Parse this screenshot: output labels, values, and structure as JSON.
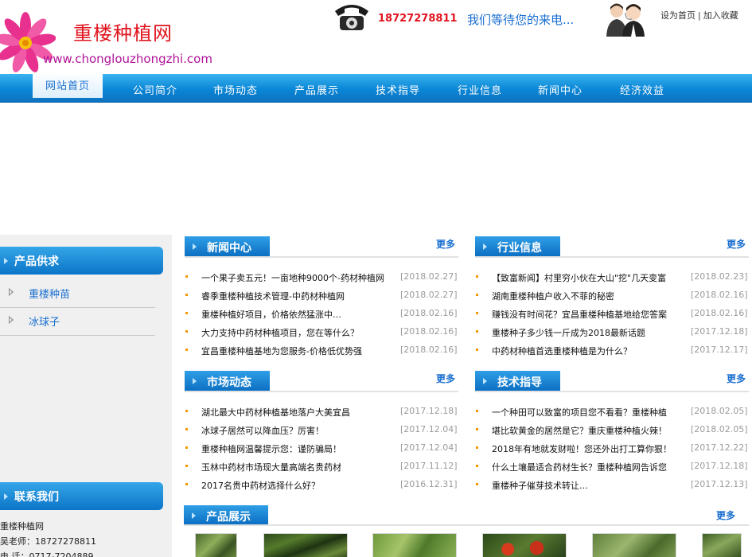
{
  "header": {
    "site_title": "重楼种植网",
    "site_url": "www.chonglouzhongzhi.com",
    "phone": "18727278811",
    "hotline_text": "我们等待您的来电...",
    "set_home": "设为首页",
    "separator": "|",
    "add_favorite": "加入收藏"
  },
  "nav": {
    "items": [
      "网站首页",
      "公司简介",
      "市场动态",
      "产品展示",
      "技术指导",
      "行业信息",
      "新闻中心",
      "经济效益"
    ]
  },
  "left": {
    "supply_title": "产品供求",
    "supply_items": [
      "重楼种苗",
      "冰球子"
    ],
    "contact_title": "联系我们",
    "contact_lines": [
      "重楼种植网",
      "吴老师：18727278811",
      "电 话：0717-7204889"
    ]
  },
  "boxes": {
    "news": {
      "title": "新闻中心",
      "more": "更多",
      "items": [
        {
          "title": "一个果子卖五元！一亩地种9000个-药材种植网",
          "date": "[2018.02.27]"
        },
        {
          "title": "睿季重楼种植技术管理-中药材种植网",
          "date": "[2018.02.27]"
        },
        {
          "title": "重楼种植好项目，价格依然猛涨中…",
          "date": "[2018.02.16]"
        },
        {
          "title": "大力支持中药材种植项目，您在等什么？",
          "date": "[2018.02.16]"
        },
        {
          "title": "宜昌重楼种植基地为您服务-价格低优势强",
          "date": "[2018.02.16]"
        }
      ]
    },
    "industry": {
      "title": "行业信息",
      "more": "更多",
      "items": [
        {
          "title": "【致富新闻】村里穷小伙在大山\"挖\"几天变富",
          "date": "[2018.02.23]"
        },
        {
          "title": "湖南重楼种植户收入不菲的秘密",
          "date": "[2018.02.16]"
        },
        {
          "title": "赚钱没有时间花？宜昌重楼种植基地给您答案",
          "date": "[2018.02.16]"
        },
        {
          "title": "重楼种子多少钱一斤成为2018最新话题",
          "date": "[2017.12.18]"
        },
        {
          "title": "中药材种植首选重楼种植是为什么？",
          "date": "[2017.12.17]"
        }
      ]
    },
    "market": {
      "title": "市场动态",
      "more": "更多",
      "items": [
        {
          "title": "湖北最大中药材种植基地落户大美宜昌",
          "date": "[2017.12.18]"
        },
        {
          "title": "冰球子居然可以降血压？厉害！",
          "date": "[2017.12.04]"
        },
        {
          "title": "重楼种植网温馨提示您：谨防骗局！",
          "date": "[2017.12.04]"
        },
        {
          "title": "玉林中药材市场现大量高端名贵药材",
          "date": "[2017.11.12]"
        },
        {
          "title": "2017名贵中药材选择什么好？",
          "date": "[2016.12.31]"
        }
      ]
    },
    "tech": {
      "title": "技术指导",
      "more": "更多",
      "items": [
        {
          "title": "一个种田可以致富的项目您不看看？重楼种植",
          "date": "[2018.02.05]"
        },
        {
          "title": "堪比软黄金的居然是它？重庆重楼种植火辣！",
          "date": "[2018.02.05]"
        },
        {
          "title": "2018年有地就发财啦！您还外出打工算你狠！",
          "date": "[2017.12.22]"
        },
        {
          "title": "什么土壤最适合药材生长？重楼种植网告诉您",
          "date": "[2017.12.18]"
        },
        {
          "title": "重楼种子催芽技术转让…",
          "date": "[2017.12.13]"
        }
      ]
    }
  },
  "products": {
    "title": "产品展示",
    "more": "更多"
  },
  "colors": {
    "nav_blue": "#0a86d6",
    "title_red": "#e0141e",
    "link_blue": "#1a6fd0",
    "bullet_orange": "#f39800"
  }
}
